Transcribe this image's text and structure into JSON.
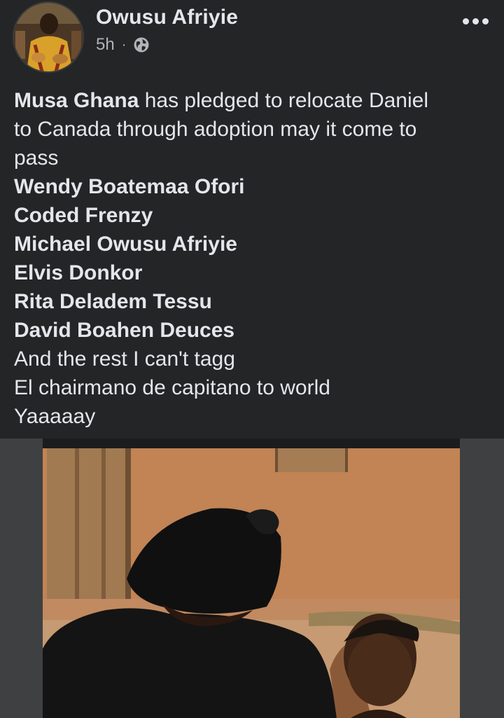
{
  "post": {
    "author": "Owusu Afriyie",
    "time": "5h",
    "separator": "·",
    "privacy_icon": "globe-icon",
    "menu_icon": "more-options-icon"
  },
  "text": {
    "pledge_name": "Musa Ghana",
    "line1_rest": " has pledged  to  relocate  Daniel",
    "line2": "to Canada  through adoption  may it come  to",
    "line3": "pass",
    "tags": [
      "Wendy Boatemaa Ofori",
      "Coded Frenzy",
      "Michael Owusu Afriyie",
      "Elvis Donkor",
      "Rita Deladem Tessu",
      "David Boahen Deuces"
    ],
    "line_rest": "And  the  rest  I can't  tagg",
    "line_chair": "El chairmano de capitano to world",
    "line_yay": "Yaaaaay"
  },
  "colors": {
    "background": "#242526",
    "text": "#e4e6eb",
    "secondary_text": "#b0b3b8",
    "photo_letterbox": "#3e4042"
  }
}
